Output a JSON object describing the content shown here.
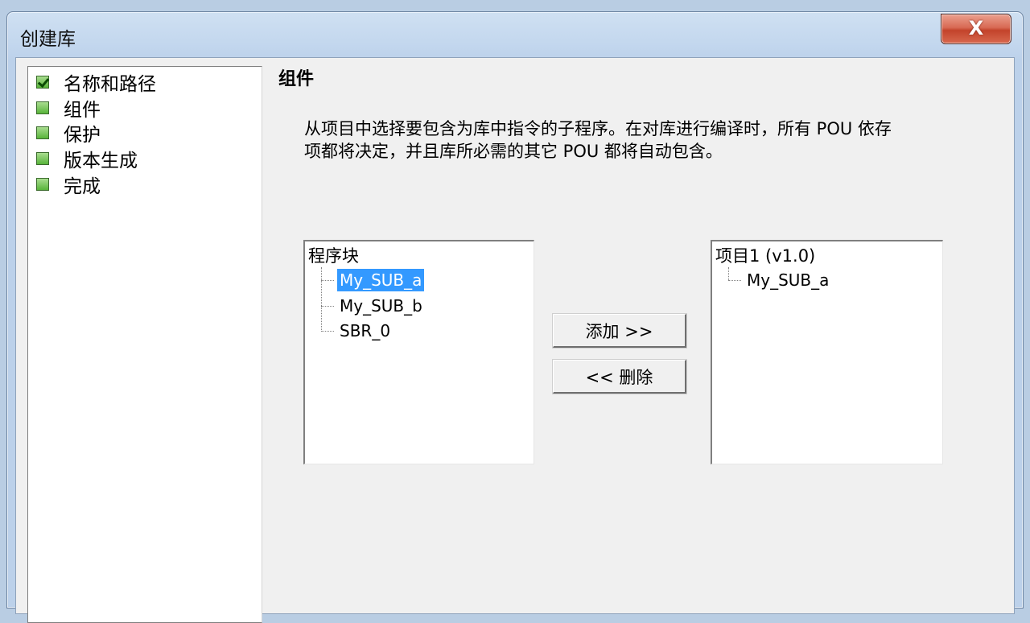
{
  "window": {
    "title": "创建库",
    "close_label": "X"
  },
  "nav": {
    "items": [
      {
        "label": "名称和路径",
        "checked": true
      },
      {
        "label": "组件",
        "checked": false
      },
      {
        "label": "保护",
        "checked": false
      },
      {
        "label": "版本生成",
        "checked": false
      },
      {
        "label": "完成",
        "checked": false
      }
    ]
  },
  "main": {
    "section_title": "组件",
    "description_line1": "从项目中选择要包含为库中指令的子程序。在对库进行编译时，所有 POU 依存",
    "description_line2": "项都将决定，并且库所必需的其它 POU 都将自动包含。",
    "source_tree": {
      "root": "程序块",
      "items": [
        "My_SUB_a",
        "My_SUB_b",
        "SBR_0"
      ],
      "selected": "My_SUB_a"
    },
    "add_button": "添加 >>",
    "remove_button": "<< 删除",
    "target_tree": {
      "root": "项目1 (v1.0)",
      "items": [
        "My_SUB_a"
      ]
    }
  }
}
